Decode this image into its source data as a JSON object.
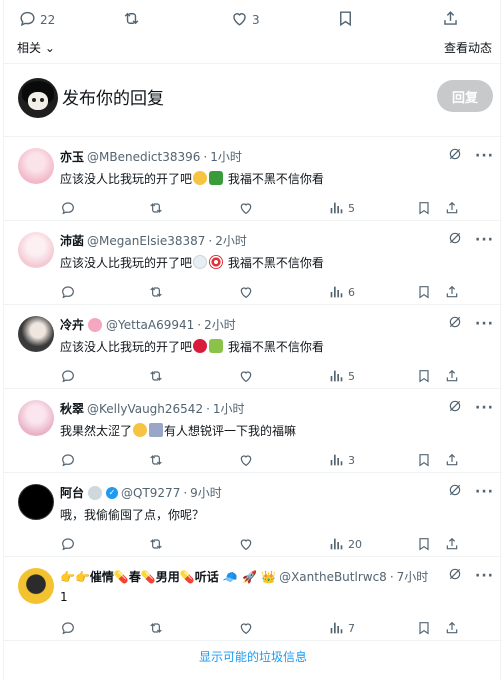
{
  "action_bar": {
    "replies": "22",
    "likes": "3"
  },
  "links": {
    "related": "相关",
    "view_activity": "查看动态"
  },
  "composer": {
    "placeholder": "发布你的回复",
    "button": "回复"
  },
  "replies": [
    {
      "name": "亦玉",
      "handle": "@MBenedict38396",
      "time": "1小时",
      "text_parts": [
        "应该没人比我玩的开了吧",
        "我福不黑不信你看"
      ],
      "emojis": [
        "#f6c343",
        "#3a9b3a"
      ],
      "views": "5"
    },
    {
      "name": "沛菡",
      "handle": "@MeganElsie38387",
      "time": "2小时",
      "text_parts": [
        "应该没人比我玩的开了吧",
        "我福不黑不信你看"
      ],
      "emojis": [
        "#e8eef2",
        "#e0303a"
      ],
      "views": "6"
    },
    {
      "name": "冷卉",
      "handle": "@YettaA69941",
      "time": "2小时",
      "text_parts": [
        "应该没人比我玩的开了吧",
        "我福不黑不信你看"
      ],
      "emojis": [
        "#d81b3a",
        "#8bc34a"
      ],
      "views": "5"
    },
    {
      "name": "秋翠",
      "handle": "@KellyVaugh26542",
      "time": "1小时",
      "text_parts": [
        "我果然太涩了",
        "有人想锐评一下我的福嘛"
      ],
      "emojis": [
        "#f6c343",
        "#9aa6c8"
      ],
      "views": "3"
    },
    {
      "name": "阿台",
      "handle": "@QT9277",
      "time": "9小时",
      "text_parts": [
        "哦，我偷偷囤了点，你呢？"
      ],
      "emojis": [],
      "views": "20"
    },
    {
      "name": "👉👉催情💊春💊男用💊听话 🧢 🚀 👑",
      "handle": "@XantheButlrwc8",
      "time": "7小时",
      "text_parts": [
        "1"
      ],
      "emojis": [],
      "views": "7"
    }
  ],
  "spam_link": "显示可能的垃圾信息",
  "colors": {
    "accent": "#1d9bf0",
    "muted": "#536471",
    "border": "#eff3f4"
  }
}
